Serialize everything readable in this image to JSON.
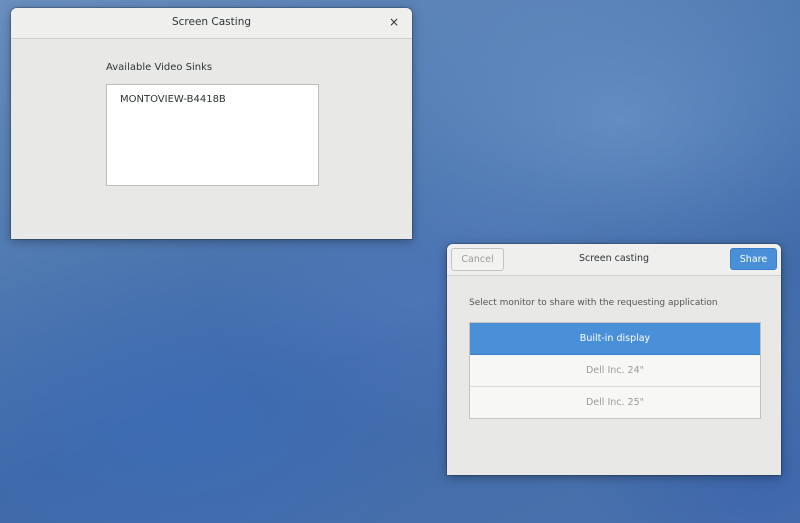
{
  "casting_window": {
    "title": "Screen Casting",
    "close_glyph": "×",
    "sinks_label": "Available Video Sinks",
    "sinks": [
      "MONTOVIEW-B4418B"
    ]
  },
  "share_dialog": {
    "title": "Screen casting",
    "cancel_label": "Cancel",
    "share_label": "Share",
    "prompt": "Select monitor to share with the requesting application",
    "monitors": [
      {
        "label": "Built-in display",
        "selected": true
      },
      {
        "label": "Dell Inc. 24\"",
        "selected": false
      },
      {
        "label": "Dell Inc. 25\"",
        "selected": false
      }
    ]
  },
  "colors": {
    "accent": "#4a90d9",
    "window_bg": "#e8e8e7",
    "text": "#2e3436",
    "dim_text": "#9a9c98"
  }
}
